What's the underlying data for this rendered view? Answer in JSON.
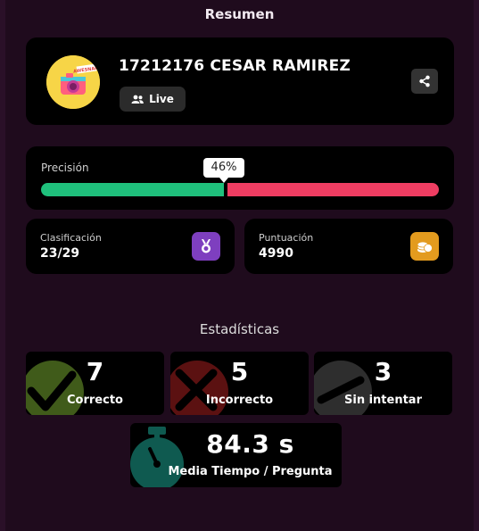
{
  "header": {
    "title": "Resumen"
  },
  "profile": {
    "avatar_text": "AWESNAP!",
    "name": "17212176 CESAR RAMIREZ",
    "mode_label": "Live",
    "mode_icon": "users-icon",
    "share_icon": "share-icon"
  },
  "accuracy": {
    "label": "Precisión",
    "percent_label": "46%",
    "percent": 46,
    "colors": {
      "correct": "#1fc07c",
      "incorrect": "#ee3d62"
    }
  },
  "rank": {
    "label": "Clasificación",
    "value": "23/29",
    "icon": "medal-icon",
    "color": "#7e3fbf"
  },
  "score": {
    "label": "Puntuación",
    "value": "4990",
    "icon": "coins-icon",
    "color": "#e39b1e"
  },
  "statistics": {
    "title": "Estadísticas",
    "correct": {
      "value": "7",
      "label": "Correcto",
      "icon": "check-icon"
    },
    "incorrect": {
      "value": "5",
      "label": "Incorrecto",
      "icon": "cross-icon"
    },
    "unattempted": {
      "value": "3",
      "label": "Sin intentar",
      "icon": "minus-icon"
    },
    "avg_time": {
      "value": "84.3 s",
      "label": "Media Tiempo / Pregunta",
      "icon": "stopwatch-icon"
    }
  }
}
